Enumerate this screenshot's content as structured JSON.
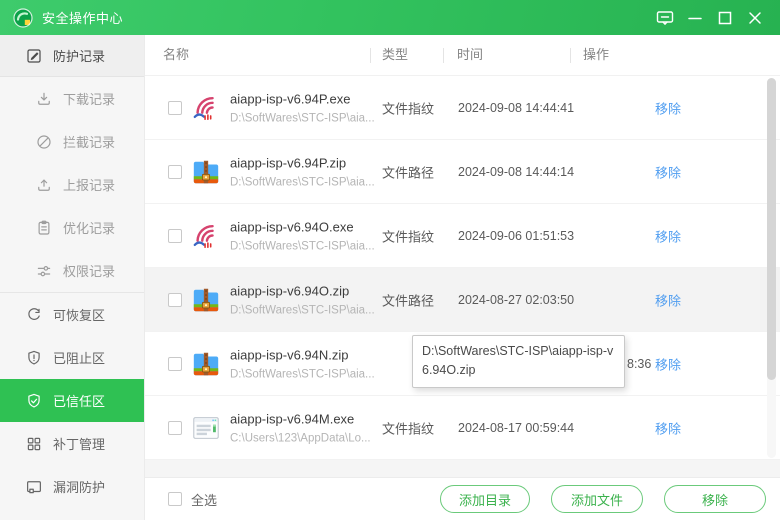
{
  "colors": {
    "accent": "#2fc153",
    "link": "#4f9df0",
    "btn_green": "#3bb24d",
    "btn_border": "#6bca7b",
    "titlebar_start": "#3ecb6c",
    "titlebar_end": "#27b251"
  },
  "window": {
    "title": "安全操作中心",
    "controls": [
      "feedback",
      "minimize",
      "maximize",
      "close"
    ]
  },
  "sidebar": {
    "items": [
      {
        "name": "protection-records",
        "label": "防护记录",
        "icon": "edit-record-icon",
        "kind": "header"
      },
      {
        "name": "download-records",
        "label": "下载记录",
        "icon": "download-icon",
        "kind": "sub"
      },
      {
        "name": "intercept-records",
        "label": "拦截记录",
        "icon": "block-icon",
        "kind": "sub"
      },
      {
        "name": "report-records",
        "label": "上报记录",
        "icon": "upload-icon",
        "kind": "sub"
      },
      {
        "name": "optimize-records",
        "label": "优化记录",
        "icon": "clipboard-icon",
        "kind": "sub"
      },
      {
        "name": "permission-records",
        "label": "权限记录",
        "icon": "permissions-icon",
        "kind": "sub"
      },
      {
        "name": "recoverable-zone",
        "label": "可恢复区",
        "icon": "restore-icon",
        "kind": "section",
        "divider_before": true
      },
      {
        "name": "blocked-zone",
        "label": "已阻止区",
        "icon": "shield-alert-icon",
        "kind": "section"
      },
      {
        "name": "trusted-zone",
        "label": "已信任区",
        "icon": "shield-check-icon",
        "kind": "section",
        "active": true
      },
      {
        "name": "patch-management",
        "label": "补丁管理",
        "icon": "patch-icon",
        "kind": "section"
      },
      {
        "name": "vulnerability-protection",
        "label": "漏洞防护",
        "icon": "vulnerability-icon",
        "kind": "section"
      }
    ]
  },
  "table": {
    "columns": [
      "名称",
      "类型",
      "时间",
      "操作"
    ],
    "rows": [
      {
        "name": "aiapp-isp-v6.94P.exe",
        "path": "D:\\SoftWares\\STC-ISP\\aia...",
        "type": "文件指纹",
        "time": "2024-09-08 14:44:41",
        "action": "移除",
        "icon": "stc-isp-app-icon"
      },
      {
        "name": "aiapp-isp-v6.94P.zip",
        "path": "D:\\SoftWares\\STC-ISP\\aia...",
        "type": "文件路径",
        "time": "2024-09-08 14:44:14",
        "action": "移除",
        "icon": "zip-archive-icon"
      },
      {
        "name": "aiapp-isp-v6.94O.exe",
        "path": "D:\\SoftWares\\STC-ISP\\aia...",
        "type": "文件指纹",
        "time": "2024-09-06 01:51:53",
        "action": "移除",
        "icon": "stc-isp-app-icon"
      },
      {
        "name": "aiapp-isp-v6.94O.zip",
        "path": "D:\\SoftWares\\STC-ISP\\aia...",
        "type": "文件路径",
        "time": "2024-08-27 02:03:50",
        "action": "移除",
        "icon": "zip-archive-icon",
        "hovered": true
      },
      {
        "name": "aiapp-isp-v6.94N.zip",
        "path": "D:\\SoftWares\\STC-ISP\\aia...",
        "type": "",
        "time": "8:36",
        "action": "移除",
        "icon": "zip-archive-icon",
        "time_partial": true
      },
      {
        "name": "aiapp-isp-v6.94M.exe",
        "path": "C:\\Users\\123\\AppData\\Lo...",
        "type": "文件指纹",
        "time": "2024-08-17 00:59:44",
        "action": "移除",
        "icon": "app-window-icon"
      }
    ]
  },
  "tooltip": {
    "text": "D:\\SoftWares\\STC-ISP\\aiapp-isp-v6.94O.zip"
  },
  "footer": {
    "select_all": "全选",
    "buttons": [
      {
        "name": "add-directory-button",
        "label": "添加目录"
      },
      {
        "name": "add-file-button",
        "label": "添加文件"
      },
      {
        "name": "remove-button",
        "label": "移除"
      }
    ]
  }
}
